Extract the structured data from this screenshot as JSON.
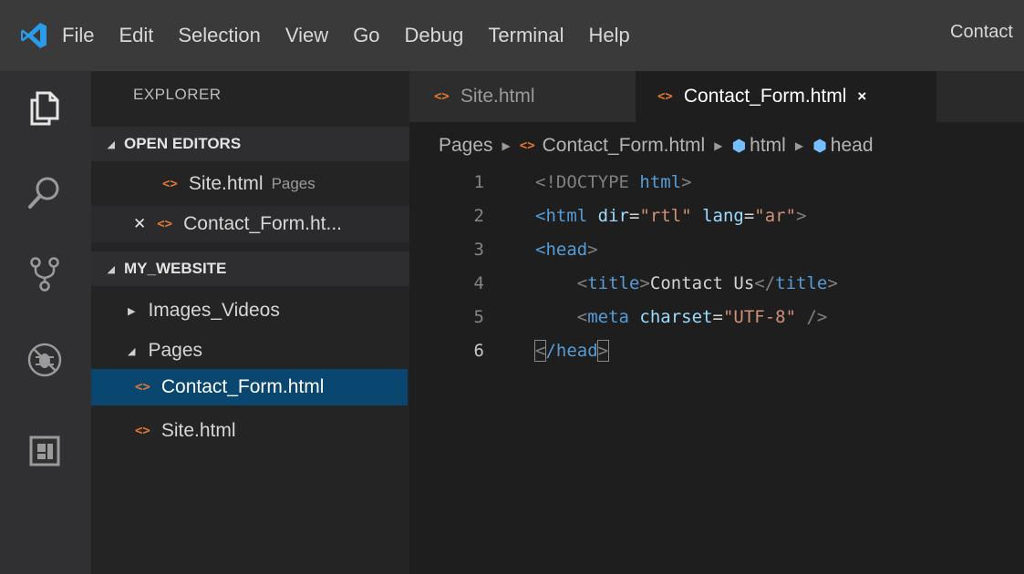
{
  "menubar": {
    "logo_icon": "vscode-logo-icon",
    "items": [
      "File",
      "Edit",
      "Selection",
      "View",
      "Go",
      "Debug",
      "Terminal",
      "Help"
    ],
    "window_title": "Contact"
  },
  "activitybar": {
    "icons": [
      "files-icon",
      "search-icon",
      "source-control-icon",
      "debug-icon",
      "extensions-icon"
    ]
  },
  "sidebar": {
    "title": "EXPLORER",
    "open_editors": {
      "header": "OPEN EDITORS",
      "items": [
        {
          "name": "Site.html",
          "description": "Pages"
        },
        {
          "name": "Contact_Form.ht...",
          "description": ""
        }
      ]
    },
    "workspace": {
      "header": "MY_WEBSITE",
      "items": [
        {
          "label": "Images_Videos"
        },
        {
          "label": "Pages"
        },
        {
          "label": "Contact_Form.html"
        },
        {
          "label": "Site.html"
        }
      ]
    }
  },
  "editor": {
    "tabs": [
      {
        "label": "Site.html",
        "active": false
      },
      {
        "label": "Contact_Form.html",
        "active": true,
        "close": "×"
      }
    ],
    "breadcrumb": [
      "Pages",
      "Contact_Form.html",
      "html",
      "head"
    ],
    "code_lines": [
      {
        "number": "1"
      },
      {
        "number": "2"
      },
      {
        "number": "3"
      },
      {
        "number": "4"
      },
      {
        "number": "5"
      },
      {
        "number": "6"
      }
    ],
    "code_text": {
      "l1_doctype": "<!DOCTYPE",
      "l1_html": " html",
      "l1_close": ">",
      "l2_open": "<",
      "l2_tag": "html",
      "l2_attr1": " dir",
      "l2_eq1": "=",
      "l2_val1": "\"rtl\"",
      "l2_attr2": " lang",
      "l2_eq2": "=",
      "l2_val2": "\"ar\"",
      "l2_close": ">",
      "l3_open": "<",
      "l3_tag": "head",
      "l3_close": ">",
      "l4_indent": "    ",
      "l4_open": "<",
      "l4_tag": "title",
      "l4_gt": ">",
      "l4_text": "Contact Us",
      "l4_close_open": "</",
      "l4_close_tag": "title",
      "l4_close_gt": ">",
      "l5_indent": "    ",
      "l5_open": "<",
      "l5_tag": "meta",
      "l5_attr": " charset",
      "l5_eq": "=",
      "l5_val": "\"UTF-8\"",
      "l5_close": " />",
      "l6_open": "<",
      "l6_slash_tag": "/head",
      "l6_close": ">"
    }
  },
  "colors": {
    "menubar_bg": "#3a3a3b",
    "sidebar_bg": "#242425",
    "editor_bg": "#1e1e1e",
    "selection_bg": "#094771",
    "html_icon": "#e37933",
    "tag_blue": "#569cd6",
    "string_orange": "#ce9178"
  }
}
